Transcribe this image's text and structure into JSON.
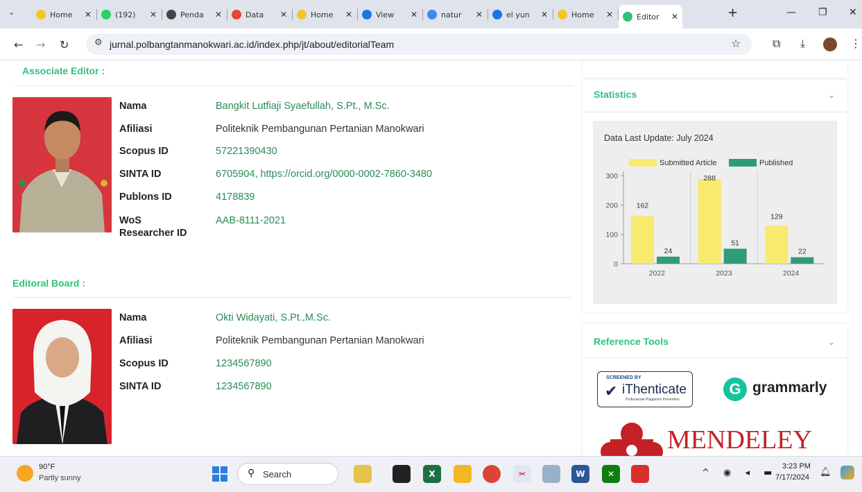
{
  "browser": {
    "tabs": [
      {
        "label": "Home",
        "icon": "smiley-icon",
        "color": "#f3c623"
      },
      {
        "label": "(192)",
        "icon": "whatsapp-icon",
        "color": "#25d366"
      },
      {
        "label": "Penda",
        "icon": "globe-icon",
        "color": "#444444"
      },
      {
        "label": "Data",
        "icon": "gmail-icon",
        "color": "#ea4335"
      },
      {
        "label": "Home",
        "icon": "smiley-icon",
        "color": "#f3c623"
      },
      {
        "label": "View",
        "icon": "document-icon",
        "color": "#1a73e8"
      },
      {
        "label": "natur",
        "icon": "google-icon",
        "color": "#4285f4"
      },
      {
        "label": "el yun",
        "icon": "search-icon",
        "color": "#1a73e8"
      },
      {
        "label": "Home",
        "icon": "smiley-icon",
        "color": "#f3c623"
      },
      {
        "label": "Editor",
        "icon": "journal-icon",
        "color": "#2ec27e"
      }
    ],
    "url": "jurnal.polbangtanmanokwari.ac.id/index.php/jt/about/editorialTeam"
  },
  "page": {
    "associate_title": "Associate Editor :",
    "board_title": "Editoral Board :",
    "person1": {
      "rows": [
        {
          "label": "Nama",
          "value": "Bangkit Lutfiaji Syaefullah, S.Pt., M.Sc.",
          "link": true
        },
        {
          "label": "Afiliasi",
          "value": "Politeknik Pembangunan Pertanian Manokwari",
          "link": false
        },
        {
          "label": "Scopus ID",
          "value": "57221390430",
          "link": true
        },
        {
          "label": "SINTA ID",
          "value": "6705904, https://orcid.org/0000-0002-7860-3480",
          "link": true
        },
        {
          "label": "Publons ID",
          "value": "4178839",
          "link": true
        },
        {
          "label": "WoS Researcher ID",
          "value": "AAB-8111-2021",
          "link": true
        }
      ]
    },
    "person2": {
      "rows": [
        {
          "label": "Nama",
          "value": "Okti Widayati, S.Pt.,M.Sc.",
          "link": true
        },
        {
          "label": "Afiliasi",
          "value": "Politeknik Pembangunan Pertanian Manokwari",
          "link": false
        },
        {
          "label": "Scopus ID",
          "value": "1234567890",
          "link": true
        },
        {
          "label": "SINTA ID",
          "value": "1234567890",
          "link": true
        }
      ]
    }
  },
  "sidebar": {
    "statistics_title": "Statistics",
    "reference_title": "Reference Tools",
    "ithenticate": {
      "top": "SCREENED BY",
      "name": "iThenticate",
      "sub": "Professional Plagiarism Prevention"
    },
    "grammarly": "grammarly",
    "mendeley": "MENDELEY"
  },
  "chart_data": {
    "type": "bar",
    "title": "Data Last Update: July 2024",
    "categories": [
      "2022",
      "2023",
      "2024"
    ],
    "series": [
      {
        "name": "Submitted Article",
        "values": [
          162,
          288,
          129
        ],
        "color": "#f7ea6e"
      },
      {
        "name": "Published",
        "values": [
          24,
          51,
          22
        ],
        "color": "#2e9c78"
      }
    ],
    "ylim": [
      0,
      300
    ],
    "yticks": [
      0,
      100,
      200,
      300
    ],
    "grid": "vertical",
    "legend": "top"
  },
  "taskbar": {
    "weather_temp": "90°F",
    "weather_desc": "Partly sunny",
    "search": "Search",
    "time": "3:23 PM",
    "date": "7/17/2024"
  }
}
